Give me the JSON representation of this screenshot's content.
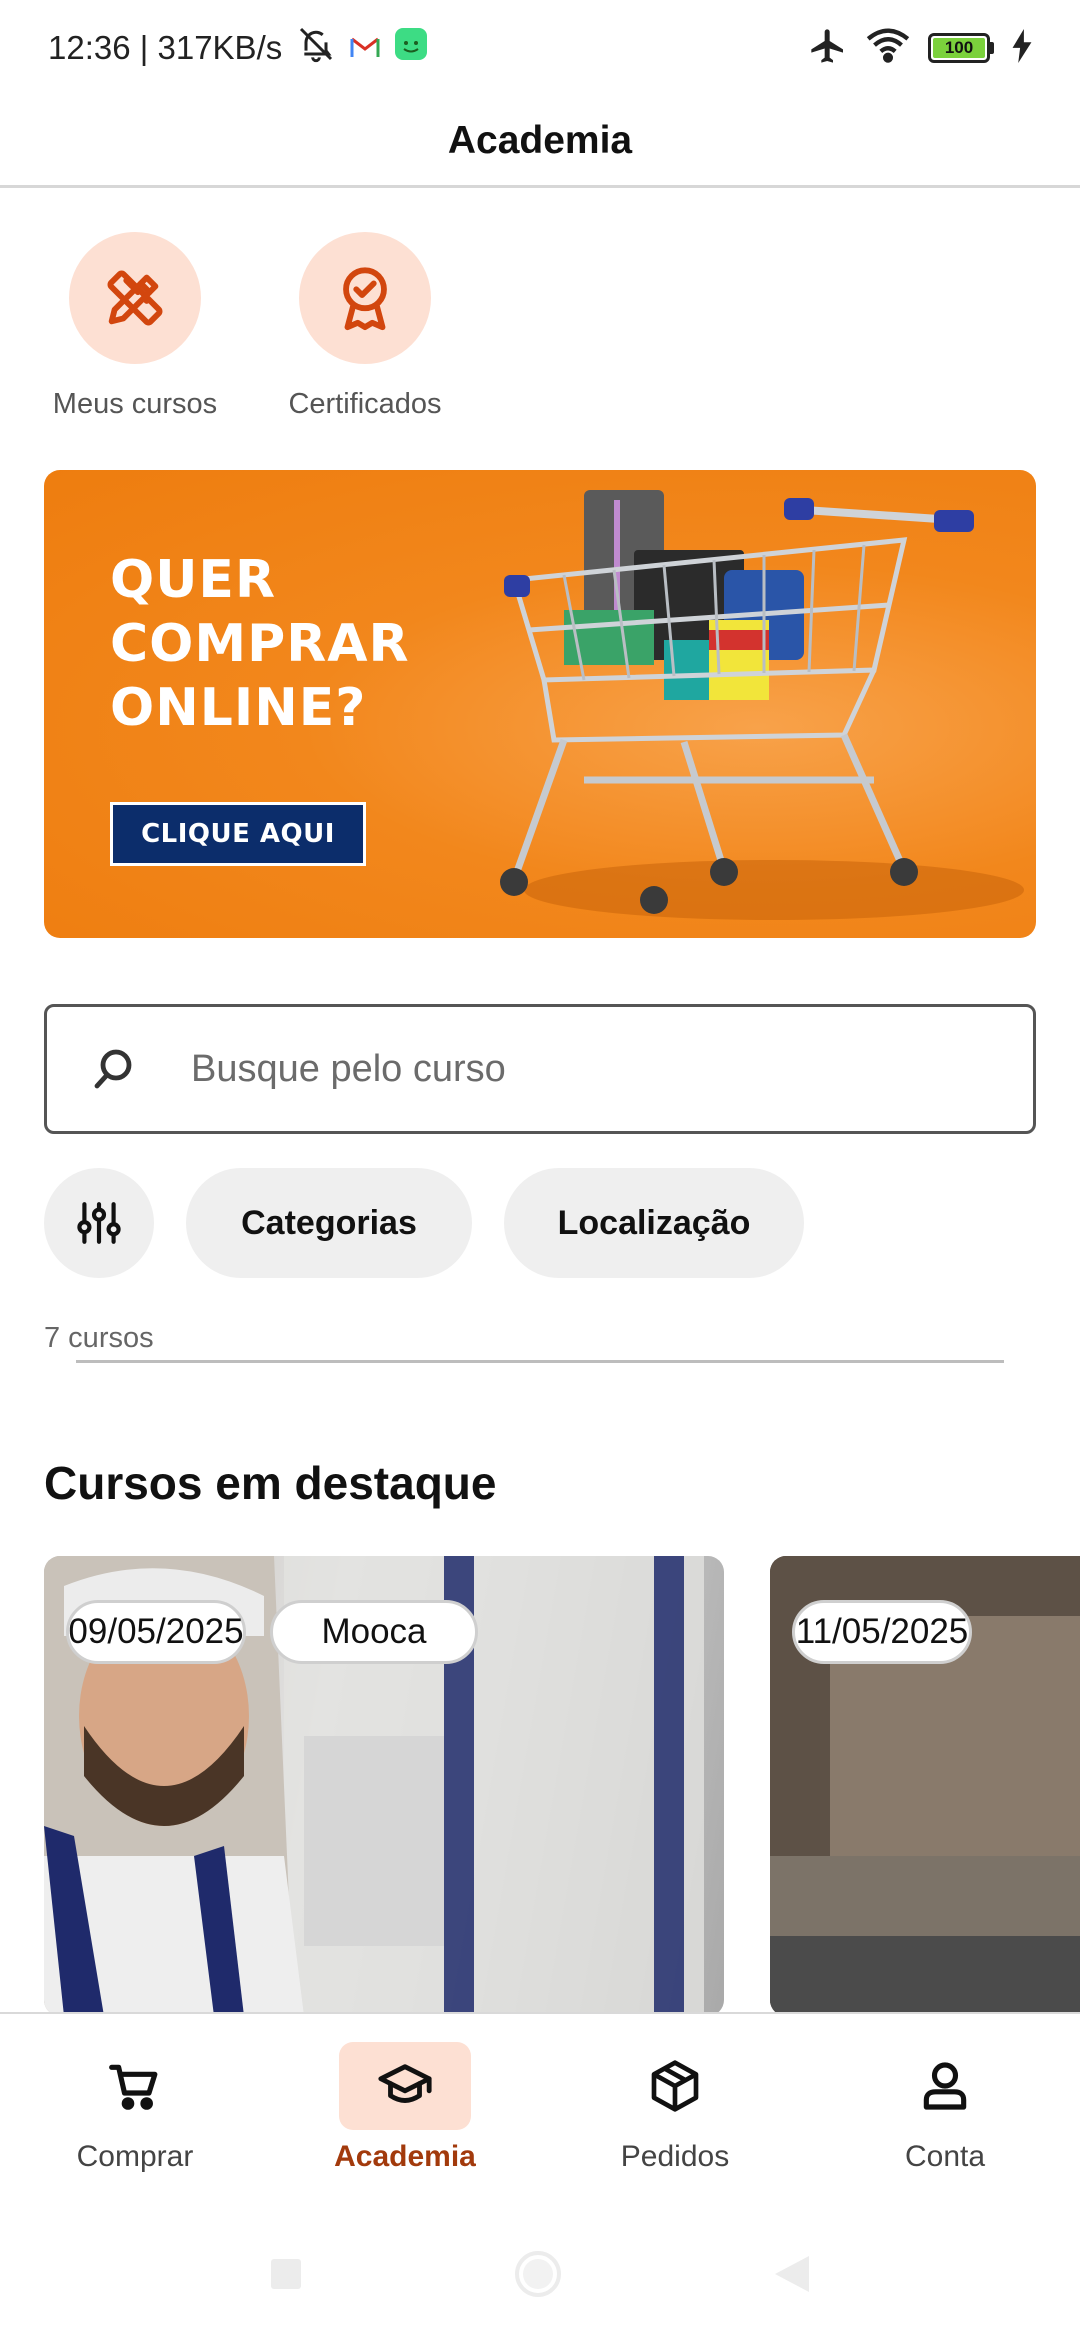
{
  "status_bar": {
    "time_speed": "12:36 | 317KB/s",
    "battery": "100",
    "icons": [
      "mute-bell-icon",
      "gmail-icon",
      "android-app-icon",
      "airplane-icon",
      "wifi-icon",
      "battery-icon",
      "charging-icon"
    ]
  },
  "app_bar": {
    "title": "Academia"
  },
  "quick_actions": [
    {
      "label": "Meus cursos",
      "icon": "ruler-pencil-icon"
    },
    {
      "label": "Certificados",
      "icon": "award-ribbon-icon"
    }
  ],
  "banner": {
    "headline": [
      "QUER",
      "COMPRAR",
      "ONLINE?"
    ],
    "cta": "CLIQUE AQUI"
  },
  "search": {
    "placeholder": "Busque pelo curso",
    "value": ""
  },
  "filters": {
    "icon": "sliders-icon",
    "chips": [
      "Categorias",
      "Localização"
    ]
  },
  "results": {
    "count": "7 cursos"
  },
  "featured": {
    "title": "Cursos em destaque",
    "cards": [
      {
        "date": "09/05/2025",
        "location": "Mooca"
      },
      {
        "date": "11/05/2025"
      }
    ]
  },
  "bottom_nav": {
    "items": [
      {
        "label": "Comprar",
        "icon": "cart-icon",
        "active": false
      },
      {
        "label": "Academia",
        "icon": "graduation-cap-icon",
        "active": true
      },
      {
        "label": "Pedidos",
        "icon": "package-icon",
        "active": false
      },
      {
        "label": "Conta",
        "icon": "user-icon",
        "active": false
      }
    ]
  },
  "colors": {
    "accent": "#a23a0c",
    "icon_orange": "#d2460e",
    "soft_peach": "#fde0d3",
    "banner_orange": "#f2871c",
    "banner_button": "#0c2d6b"
  }
}
